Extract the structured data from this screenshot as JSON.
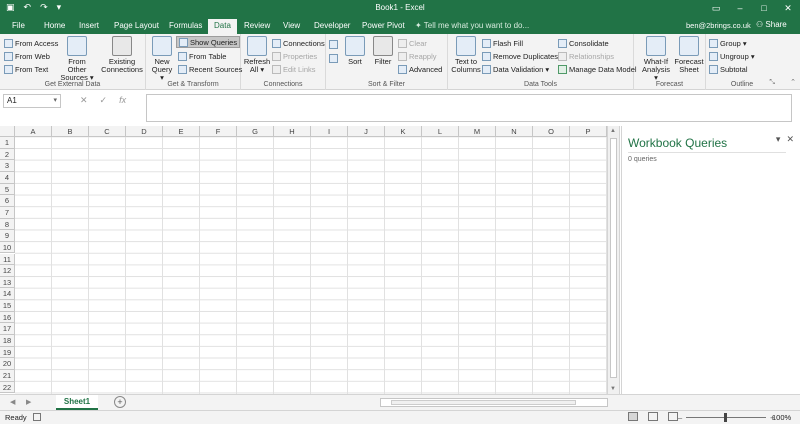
{
  "window": {
    "title": "Book1 - Excel",
    "account": "ben@2brings.co.uk",
    "share": "Share",
    "tell_me": "Tell me what you want to do..."
  },
  "tabs": [
    {
      "label": "File"
    },
    {
      "label": "Home"
    },
    {
      "label": "Insert"
    },
    {
      "label": "Page Layout"
    },
    {
      "label": "Formulas"
    },
    {
      "label": "Data",
      "active": true
    },
    {
      "label": "Review"
    },
    {
      "label": "View"
    },
    {
      "label": "Developer"
    },
    {
      "label": "Power Pivot"
    }
  ],
  "ribbon": {
    "get_external": {
      "label": "Get External Data",
      "from_access": "From Access",
      "from_web": "From Web",
      "from_text": "From Text",
      "from_other_1": "From Other",
      "from_other_2": "Sources ▾",
      "existing_1": "Existing",
      "existing_2": "Connections"
    },
    "get_transform": {
      "label": "Get & Transform",
      "new_query_1": "New",
      "new_query_2": "Query ▾",
      "show_queries": "Show Queries",
      "from_table": "From Table",
      "recent_sources": "Recent Sources"
    },
    "connections": {
      "label": "Connections",
      "refresh_1": "Refresh",
      "refresh_2": "All ▾",
      "connections": "Connections",
      "properties": "Properties",
      "edit_links": "Edit Links"
    },
    "sort_filter": {
      "label": "Sort & Filter",
      "sort": "Sort",
      "filter": "Filter",
      "clear": "Clear",
      "reapply": "Reapply",
      "advanced": "Advanced"
    },
    "data_tools": {
      "label": "Data Tools",
      "text_to_1": "Text to",
      "text_to_2": "Columns",
      "flash_fill": "Flash Fill",
      "remove_dup": "Remove Duplicates",
      "data_validation": "Data Validation ▾",
      "consolidate": "Consolidate",
      "relationships": "Relationships",
      "manage_model": "Manage Data Model"
    },
    "forecast": {
      "label": "Forecast",
      "whatif_1": "What-If",
      "whatif_2": "Analysis ▾",
      "sheet_1": "Forecast",
      "sheet_2": "Sheet"
    },
    "outline": {
      "label": "Outline",
      "group": "Group ▾",
      "ungroup": "Ungroup ▾",
      "subtotal": "Subtotal"
    }
  },
  "formula_bar": {
    "name_box": "A1",
    "fx": "fx"
  },
  "grid": {
    "columns": [
      "A",
      "B",
      "C",
      "D",
      "E",
      "F",
      "G",
      "H",
      "I",
      "J",
      "K",
      "L",
      "M",
      "N",
      "O",
      "P"
    ],
    "rows": [
      "1",
      "2",
      "3",
      "4",
      "5",
      "6",
      "7",
      "8",
      "9",
      "10",
      "11",
      "12",
      "13",
      "14",
      "15",
      "16",
      "17",
      "18",
      "19",
      "20",
      "21",
      "22"
    ]
  },
  "queries_pane": {
    "title": "Workbook Queries",
    "count": "0 queries"
  },
  "sheets": {
    "active": "Sheet1"
  },
  "status": {
    "ready": "Ready",
    "zoom": "100%"
  }
}
